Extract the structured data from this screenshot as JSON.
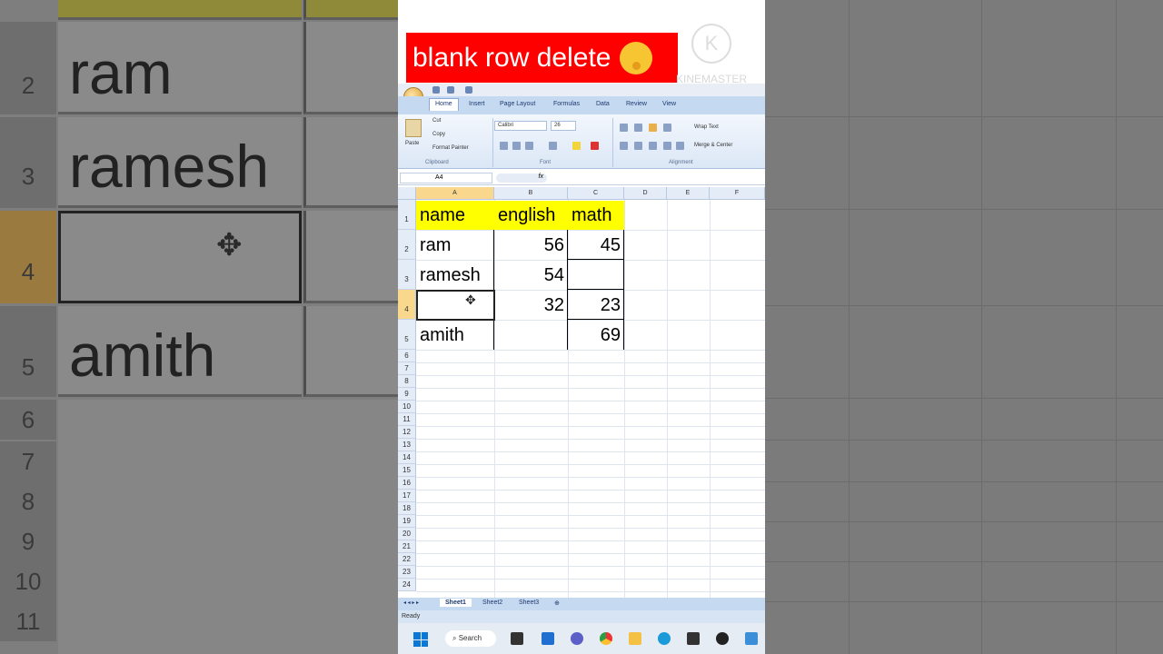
{
  "video": {
    "title": "blank row delete",
    "watermark": "KINEMASTER"
  },
  "background_left": {
    "rows": [
      {
        "num": "2",
        "text": "ram"
      },
      {
        "num": "3",
        "text": "ramesh"
      },
      {
        "num": "4",
        "text": ""
      },
      {
        "num": "5",
        "text": "amith"
      },
      {
        "num": "6",
        "text": ""
      },
      {
        "num": "7",
        "text": ""
      },
      {
        "num": "8",
        "text": ""
      },
      {
        "num": "9",
        "text": ""
      },
      {
        "num": "10",
        "text": ""
      },
      {
        "num": "11",
        "text": ""
      }
    ]
  },
  "excel": {
    "ribbon_tabs": [
      "Home",
      "Insert",
      "Page Layout",
      "Formulas",
      "Data",
      "Review",
      "View"
    ],
    "clipboard": {
      "paste": "Paste",
      "cut": "Cut",
      "copy": "Copy",
      "format_painter": "Format Painter",
      "group": "Clipboard"
    },
    "font": {
      "name": "Calibri",
      "size": "26",
      "group": "Font"
    },
    "alignment": {
      "wrap_text": "Wrap Text",
      "merge_center": "Merge & Center",
      "group": "Alignment"
    },
    "name_box": "A4",
    "fx": "fx",
    "columns": [
      "A",
      "B",
      "C",
      "D",
      "E",
      "F"
    ],
    "row_numbers": [
      "1",
      "2",
      "3",
      "4",
      "5",
      "6",
      "7",
      "8",
      "9",
      "10",
      "11",
      "12",
      "13",
      "14",
      "15",
      "16",
      "17",
      "18",
      "19",
      "20",
      "21",
      "22",
      "23",
      "24"
    ],
    "table": {
      "headers": [
        "name",
        "english",
        "math"
      ],
      "rows": [
        [
          "ram",
          "56",
          "45"
        ],
        [
          "ramesh",
          "54",
          ""
        ],
        [
          "",
          "32",
          "23"
        ],
        [
          "amith",
          "",
          "69"
        ]
      ]
    },
    "sheets": [
      "Sheet1",
      "Sheet2",
      "Sheet3"
    ],
    "status": "Ready"
  },
  "taskbar": {
    "search": "Search"
  }
}
